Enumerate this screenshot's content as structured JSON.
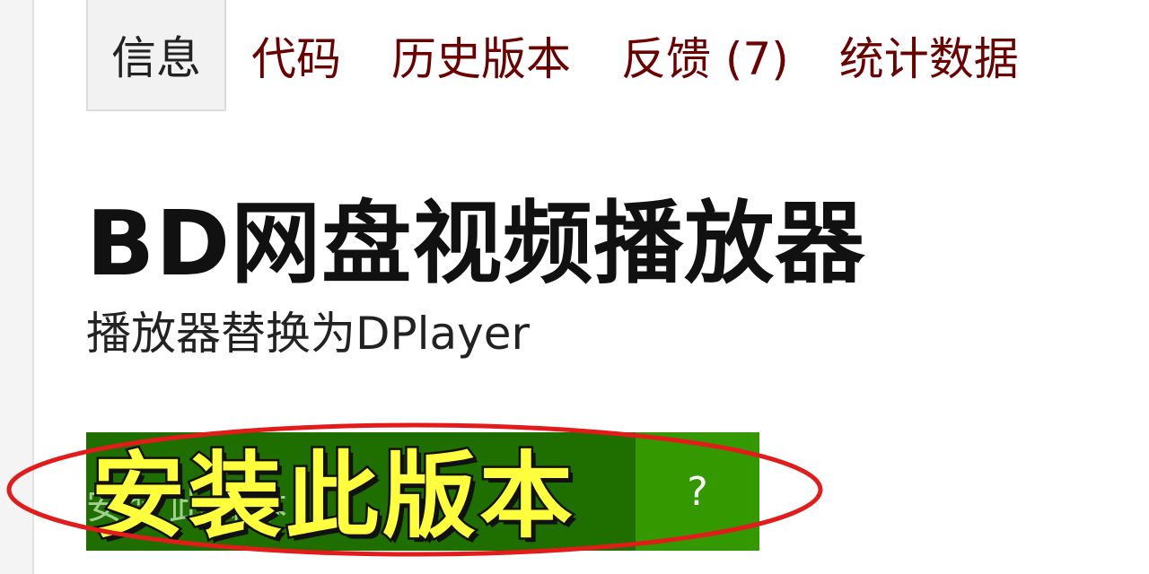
{
  "tabs": [
    {
      "label": "信息",
      "active": true
    },
    {
      "label": "代码"
    },
    {
      "label": "历史版本"
    },
    {
      "label": "反馈 (7)"
    },
    {
      "label": "统计数据"
    }
  ],
  "script": {
    "title": "BD网盘视频播放器",
    "description": "播放器替换为DPlayer"
  },
  "install": {
    "button_text": "安装此脚本",
    "help_label": "?",
    "annotation_label": "安装此版本",
    "annotation_color": "#e21b1b"
  },
  "colors": {
    "tab_link": "#6b0000",
    "install_green": "#1f6e00",
    "help_green": "#349900",
    "annotation_text": "#ffff3d"
  }
}
